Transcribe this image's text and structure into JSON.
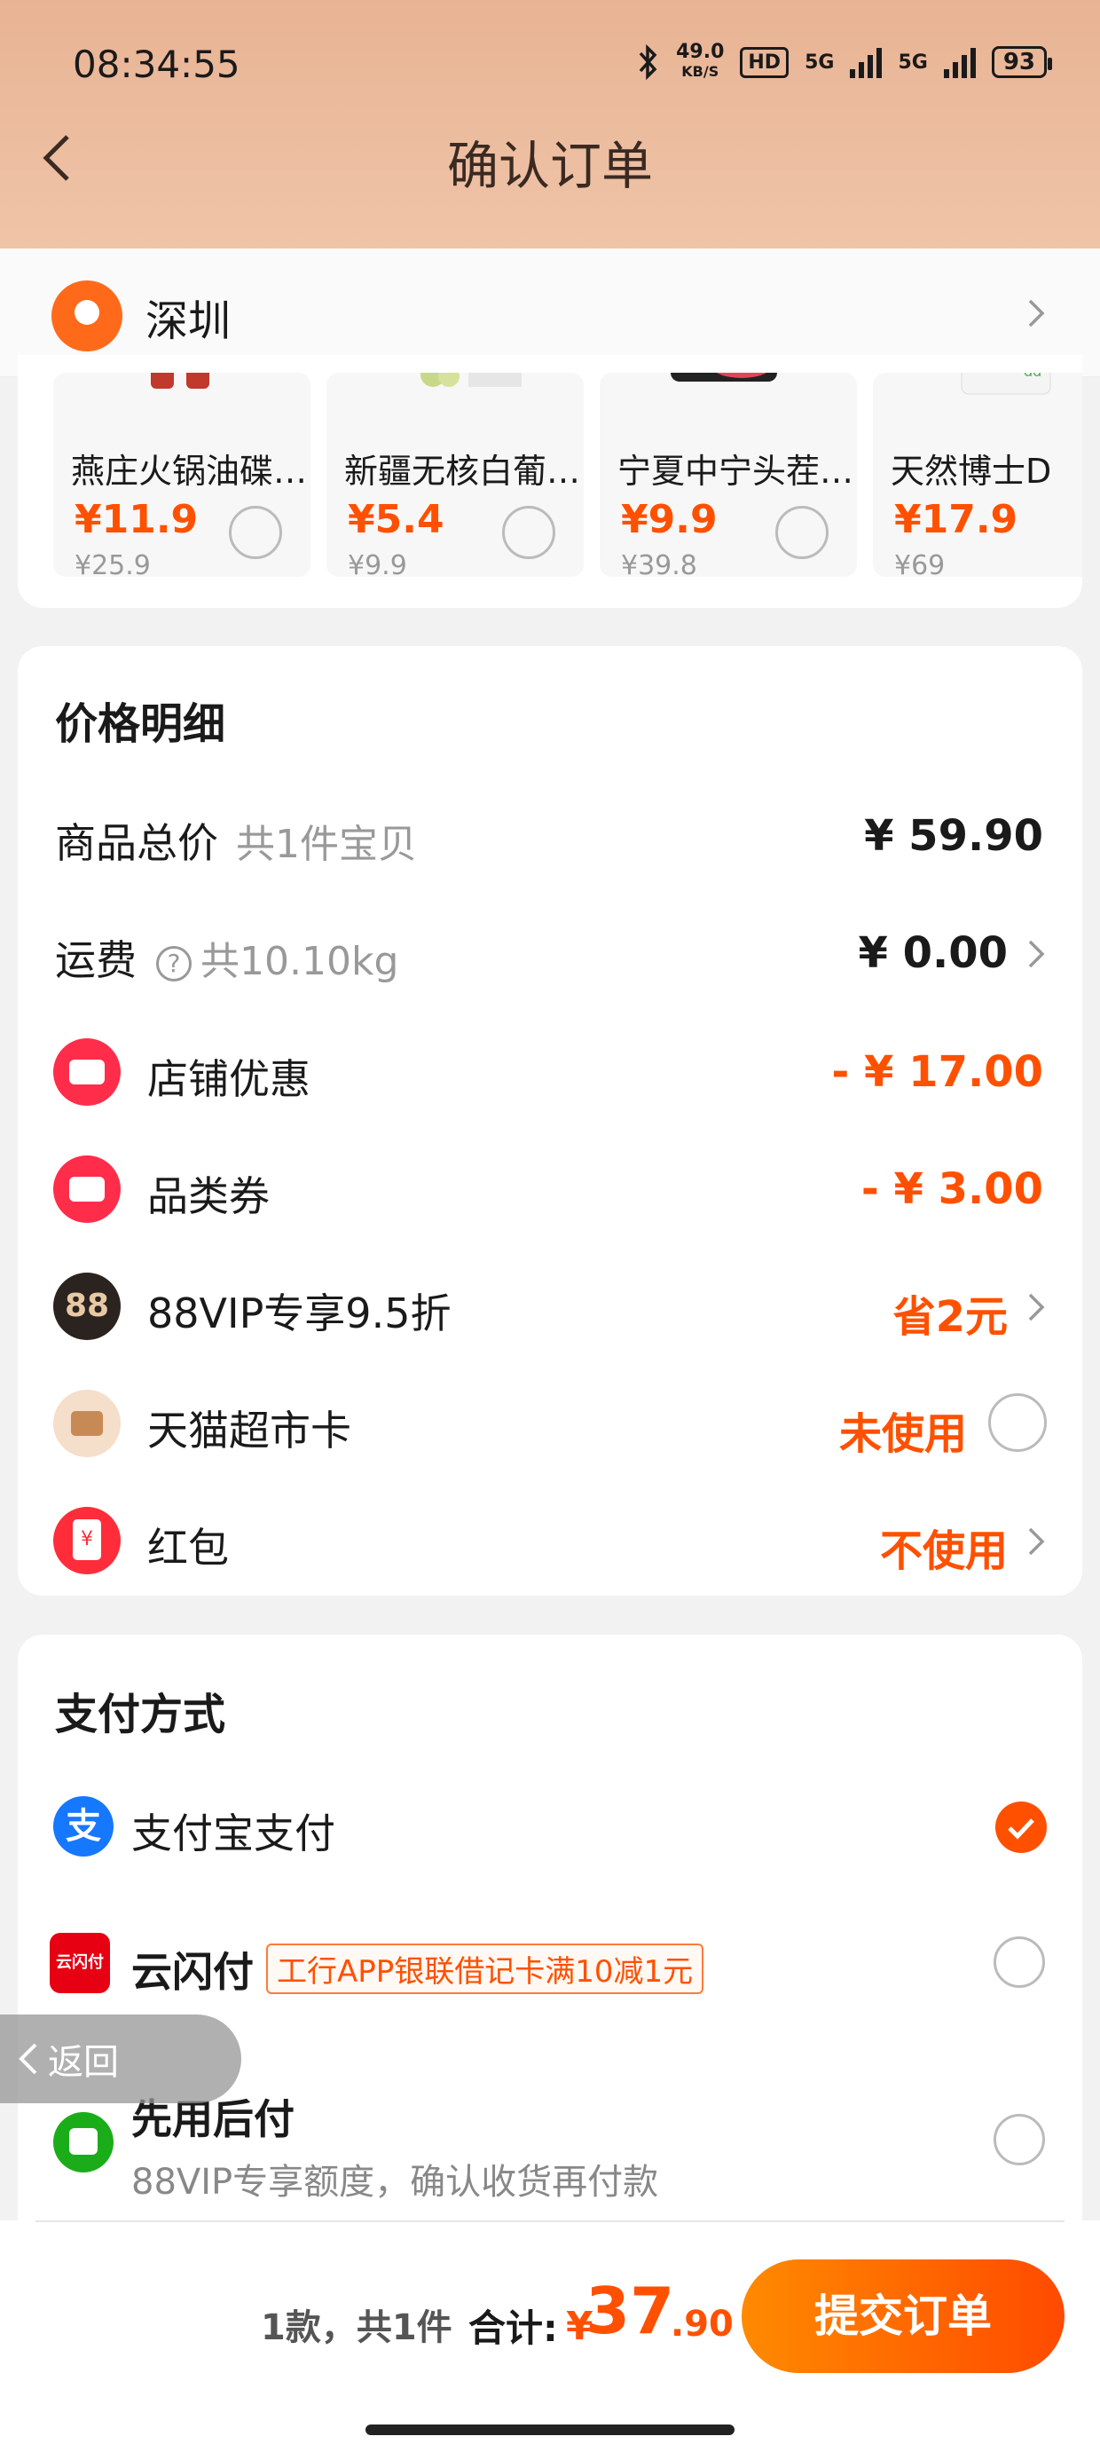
{
  "status_bar": {
    "time": "08:34:55",
    "speed_value": "49.0",
    "speed_unit": "KB/S",
    "hd": "HD",
    "sig1": "5G",
    "sig2": "5G",
    "battery": "93"
  },
  "header": {
    "title": "确认订单"
  },
  "address": {
    "city": "深圳"
  },
  "products": [
    {
      "name": "燕庄火锅油碟…",
      "price": "¥11.9",
      "orig_price": "¥25.9"
    },
    {
      "name": "新疆无核白葡…",
      "price": "¥5.4",
      "orig_price": "¥9.9"
    },
    {
      "name": "宁夏中宁头茬…",
      "price": "¥9.9",
      "orig_price": "¥39.8"
    },
    {
      "name": "天然博士D",
      "price": "¥17.9",
      "orig_price": "¥69"
    }
  ],
  "price_detail": {
    "title": "价格明细",
    "goods_total_label": "商品总价",
    "goods_total_sub": "共1件宝贝",
    "goods_total_value": "¥ 59.90",
    "freight_label": "运费",
    "freight_sub": "共10.10kg",
    "freight_value": "¥ 0.00",
    "store_discount_label": "店铺优惠",
    "store_discount_value": "- ¥ 17.00",
    "category_coupon_label": "品类券",
    "category_coupon_value": "- ¥ 3.00",
    "vip_label": "88VIP专享9.5折",
    "vip_icon_text": "88",
    "vip_value": "省2元",
    "tmall_card_label": "天猫超市卡",
    "tmall_card_value": "未使用",
    "red_packet_label": "红包",
    "red_packet_value": "不使用"
  },
  "payment": {
    "title": "支付方式",
    "alipay_label": "支付宝支付",
    "alipay_icon_text": "支",
    "unionpay_label": "云闪付",
    "unionpay_icon_text": "云闪付",
    "unionpay_promo": "工行APP银联借记卡满10减1元",
    "bnpl_label": "先用后付",
    "bnpl_desc": "88VIP专享额度，确认收货再付款"
  },
  "float_back": {
    "label": "返回"
  },
  "bottom": {
    "summary": "1款，共1件",
    "total_label": "合计:",
    "total_yen": "¥",
    "total_int": "37",
    "total_dec": ".90",
    "submit_label": "提交订单"
  },
  "colors": {
    "accent": "#ff5000",
    "header_bg": "#e8b394"
  }
}
